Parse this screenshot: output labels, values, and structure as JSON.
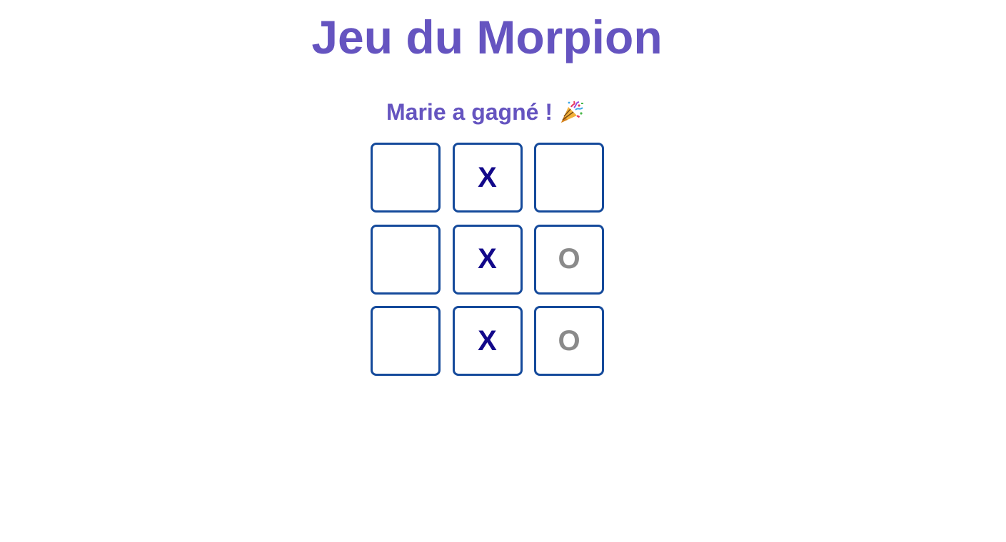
{
  "game": {
    "title": "Jeu du Morpion",
    "status": "Marie a gagné !",
    "status_emoji": "party-popper-icon",
    "board": {
      "cells": [
        "",
        "X",
        "",
        "",
        "X",
        "O",
        "",
        "X",
        "O"
      ]
    }
  },
  "colors": {
    "accent": "#6554c0",
    "cell_border": "#154a9b",
    "x_mark": "#12088a",
    "o_mark": "#8a8a8a"
  }
}
